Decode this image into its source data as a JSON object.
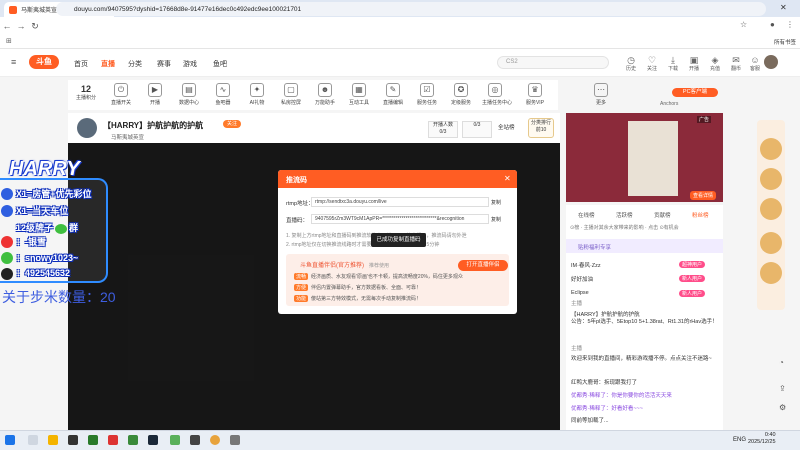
{
  "browser": {
    "tab_title": "马斯夷城英宣播_马斯夷城英宣播直",
    "url": "douyu.com/9407595?dyshid=17668d8e-91477e16dec0c492edc9ee100021701",
    "bookmarks_label": "所有书签"
  },
  "header": {
    "logo": "斗鱼",
    "nav": [
      "首页",
      "直播",
      "分类",
      "赛事",
      "游戏",
      "鱼吧"
    ],
    "search_placeholder": "CS2",
    "right_icons": [
      "历史",
      "关注",
      "下载",
      "开播",
      "充值",
      "翻币",
      "客服"
    ]
  },
  "toolbar": {
    "level_value": "12",
    "level_label": "主播积分",
    "items": [
      "直播开关",
      "开播",
      "数据中心",
      "鱼吧器",
      "AI礼物",
      "私房控屏",
      "万能助手",
      "互动工具",
      "直播编辑",
      "服务任务",
      "定级服务",
      "主播任务中心",
      "服务VIP",
      "更多"
    ],
    "pc_client": "PC客户端",
    "anchors": "Anchors"
  },
  "room": {
    "title": "【HARRY】护航护航的护航",
    "follow": "关注",
    "meta": "马斯夷城英宣",
    "box1": "开播人数\n0/3",
    "box2": "0/3",
    "fullnet": "全站榜",
    "rank": "分类排行\n前10"
  },
  "right": {
    "ad_label": "广告",
    "ad_btn": "查看详情",
    "chat_tabs": [
      "在线榜",
      "活跃榜",
      "贡献榜",
      "粉丝榜"
    ],
    "rank_head": "⊙榜 · 主播对其余大家带来的影响 · 点击 ⊙有机会",
    "fan_head": "贴粉福利专享",
    "chat_lines": [
      "IM·春风·Zzz",
      "好好加油",
      "Eclipse",
      "主播",
      "【HARRY】护航护航的护航",
      "主播"
    ],
    "pills": [
      "超神用户",
      "新人用户",
      "新人用户"
    ],
    "notice": "公告：5年pl选手、5Etop10 5+1.38rat、Rt1.31的rHav选手！",
    "welcome": "欢迎来到我的直播间，精彩游戏播不停。点点关注不迷路~",
    "msgs": [
      "红鸭大鹿哥：拆现跟我打了",
      "优都秀·稀释了：你是你要你的活活天天来",
      "优都秀·稀释了：好看好看~~~",
      "同前等加载了..."
    ]
  },
  "modal": {
    "title": "推流码",
    "rtmp_label": "rtmp地址：",
    "rtmp_value": "rtmp://sendtxc3a.douyu.com/live",
    "key_label": "直播码：",
    "key_value": "9407595rZm3WT9cM1ApPR=****************************&recognition",
    "copy": "复制",
    "note1": "1. 复制上方rtmp地址和直播码到推流软件中，就可以开始直播了，推流码请勿外泄",
    "note2": "2. rtmp地址仅在切换推流线路时才需要更新，直播码有效期约为5分钟",
    "toast": "已成功复制直播码",
    "promo_title": "斗鱼直播伴侣(官方推荐)",
    "promo_tag": "推荐使用",
    "open_btn": "打开直播伴侣",
    "promo_lines": [
      {
        "tag": "流畅",
        "text": "经济画质、水友观看'原画'也不卡顿，提高流畅度20%，码住更多观众"
      },
      {
        "tag": "方便",
        "text": "伴侣内置弹幕助手，官方数据看板、全面、可靠！"
      },
      {
        "tag": "功能",
        "text": "傻站第三方特效模式，无需每次手动复制推流码！"
      }
    ]
  },
  "overlay_text": {
    "harry": "HARRY",
    "line1": "X1=房管+优先彩位",
    "line2": "X1=当天车位",
    "line3": "12级牌子",
    "line3b": "群",
    "line4": "：-银雪",
    "line5": "：snowy1023~",
    "line6": "：492545632",
    "count_label": "关于步米数量：20"
  },
  "taskbar": {
    "lang": "ENG",
    "time": "0:40",
    "date": "2025/12/25"
  }
}
